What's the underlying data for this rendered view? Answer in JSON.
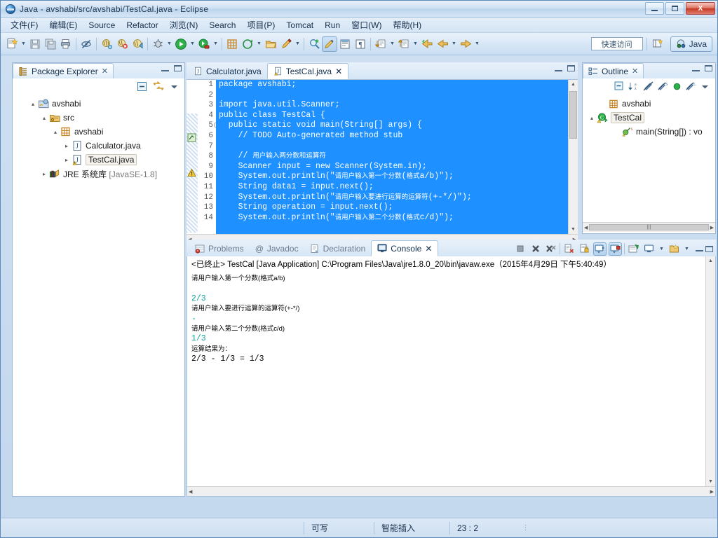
{
  "window": {
    "title": "Java - avshabi/src/avshabi/TestCal.java - Eclipse",
    "minimize_label": "Minimize",
    "maximize_label": "Maximize",
    "close_label": "X"
  },
  "menubar": {
    "items": [
      {
        "label": "文件(F)",
        "mnemonic": "F"
      },
      {
        "label": "编辑(E)",
        "mnemonic": "E"
      },
      {
        "label": "Source",
        "mnemonic": "S"
      },
      {
        "label": "Refactor",
        "mnemonic": "R"
      },
      {
        "label": "浏览(N)",
        "mnemonic": "N"
      },
      {
        "label": "Search",
        "mnemonic": "a"
      },
      {
        "label": "项目(P)",
        "mnemonic": "P"
      },
      {
        "label": "Tomcat",
        "mnemonic": ""
      },
      {
        "label": "Run",
        "mnemonic": "R"
      },
      {
        "label": "窗口(W)",
        "mnemonic": "W"
      },
      {
        "label": "帮助(H)",
        "mnemonic": "H"
      }
    ]
  },
  "toolbar": {
    "quick_access": "快速访问",
    "perspective": "Java",
    "icons": [
      "new-wizard-icon",
      "new-wizard-dropdown-icon",
      "save-icon",
      "save-all-icon",
      "print-icon",
      "toggle-mark-occurrences-icon",
      "open-type-icon",
      "open-type-error-icon",
      "open-task-icon",
      "debug-icon",
      "debug-dropdown-icon",
      "run-icon",
      "run-dropdown-icon",
      "external-tools-icon",
      "external-tools-dropdown-icon",
      "new-java-project-icon",
      "new-package-icon",
      "open-resource-icon",
      "new-class-icon",
      "new-class-dropdown-icon",
      "search-icon",
      "toggle-block-selection-icon",
      "show-whitespace-icon",
      "pilcrow-icon",
      "next-annotation-icon",
      "next-annotation-dropdown-icon",
      "previous-annotation-icon",
      "previous-annotation-dropdown-icon",
      "back-history-icon",
      "back-icon",
      "back-dropdown-icon",
      "forward-icon",
      "forward-dropdown-icon",
      "open-perspective-icon"
    ]
  },
  "package_explorer": {
    "tab_label": "Package Explorer",
    "close_label": "✕",
    "tools": [
      "collapse-all-icon",
      "link-with-editor-icon",
      "view-menu-icon"
    ],
    "tree": [
      {
        "label": "avshabi",
        "indent": 0,
        "arrow": "▴",
        "icon": "java-project-icon",
        "selected": false
      },
      {
        "label": "src",
        "indent": 1,
        "arrow": "▴",
        "icon": "source-folder-icon",
        "selected": false
      },
      {
        "label": "avshabi",
        "indent": 2,
        "arrow": "▴",
        "icon": "package-icon",
        "selected": false
      },
      {
        "label": "Calculator.java",
        "indent": 3,
        "arrow": "▸",
        "icon": "java-file-icon",
        "selected": false
      },
      {
        "label": "TestCal.java",
        "indent": 3,
        "arrow": "▸",
        "icon": "java-file-warning-icon",
        "selected": true
      },
      {
        "label": "JRE 系统库",
        "suffix": "[JavaSE-1.8]",
        "indent": 1,
        "arrow": "▸",
        "icon": "library-icon",
        "selected": false
      }
    ]
  },
  "editor": {
    "tabs": [
      {
        "label": "Calculator.java",
        "active": false,
        "icon": "java-file-icon",
        "closeable": false
      },
      {
        "label": "TestCal.java",
        "active": true,
        "icon": "java-file-warning-icon",
        "closeable": true,
        "close_label": "✕"
      }
    ],
    "first_line": 1,
    "lines": [
      {
        "n": 1,
        "folding": false,
        "text": "package avshabi;"
      },
      {
        "n": 2,
        "folding": false,
        "text": ""
      },
      {
        "n": 3,
        "folding": false,
        "text": "import java.util.Scanner;"
      },
      {
        "n": 4,
        "folding": false,
        "text": "public class TestCal {"
      },
      {
        "n": 5,
        "folding": true,
        "text": "  public static void main(String[] args) {"
      },
      {
        "n": 6,
        "folding": false,
        "text": "    // TODO Auto-generated method stub"
      },
      {
        "n": 7,
        "folding": false,
        "text": ""
      },
      {
        "n": 8,
        "folding": false,
        "text": "    // 用户输入两分数和运算符"
      },
      {
        "n": 9,
        "folding": false,
        "text": "    Scanner input = new Scanner(System.in);"
      },
      {
        "n": 10,
        "folding": false,
        "text": "    System.out.println(\"请用户输入第一个分数(格式a/b)\");"
      },
      {
        "n": 11,
        "folding": false,
        "text": "    String data1 = input.next();"
      },
      {
        "n": 12,
        "folding": false,
        "text": "    System.out.println(\"请用户输入要进行运算的运算符(+-*/)\");"
      },
      {
        "n": 13,
        "folding": false,
        "text": "    String operation = input.next();"
      },
      {
        "n": 14,
        "folding": false,
        "text": "    System.out.println(\"请用户输入第二个分数(格式c/d)\");"
      }
    ]
  },
  "outline": {
    "tab_label": "Outline",
    "close_label": "✕",
    "tools": [
      "collapse-all-icon",
      "sort-icon",
      "hide-fields-icon",
      "hide-static-icon",
      "hide-nonpublic-icon",
      "hide-local-icon",
      "view-menu-icon"
    ],
    "tree": [
      {
        "label": "avshabi",
        "indent": 1,
        "arrow": "",
        "icon": "package-declaration-icon",
        "selected": false
      },
      {
        "label": "TestCal",
        "indent": 1,
        "arrow": "▴",
        "icon": "class-warning-icon",
        "selected": true
      },
      {
        "label": "main(String[]) : vo",
        "indent": 2,
        "arrow": "",
        "icon": "static-method-icon",
        "selected": false
      }
    ]
  },
  "console": {
    "tabs": [
      {
        "label": "Problems",
        "active": false,
        "icon": "problems-icon"
      },
      {
        "label": "Javadoc",
        "active": false,
        "icon": "javadoc-icon"
      },
      {
        "label": "Declaration",
        "active": false,
        "icon": "declaration-icon"
      },
      {
        "label": "Console",
        "active": true,
        "icon": "console-icon",
        "close_label": "✕"
      }
    ],
    "tools": [
      "terminate-icon",
      "remove-launch-icon",
      "remove-all-launches-icon",
      "clear-console-icon",
      "scroll-lock-icon",
      "pin-console-icon",
      "display-selected-console-icon",
      "open-console-icon",
      "open-console-dropdown-icon",
      "new-console-view-icon",
      "new-console-dropdown-icon",
      "minimize-icon",
      "maximize-icon"
    ],
    "header": "<已终止> TestCal [Java Application] C:\\Program Files\\Java\\jre1.8.0_20\\bin\\javaw.exe（2015年4月29日 下午5:40:49）",
    "output": [
      {
        "text": "请用户输入第一个分数(格式a/b)",
        "style": "zh"
      },
      {
        "text": "",
        "style": "zh"
      },
      {
        "text": "2/3",
        "style": "inp"
      },
      {
        "text": "请用户输入要进行运算的运算符(+-*/)",
        "style": "zh"
      },
      {
        "text": "-",
        "style": "inp"
      },
      {
        "text": "请用户输入第二个分数(格式c/d)",
        "style": "zh"
      },
      {
        "text": "1/3",
        "style": "inp"
      },
      {
        "text": "运算结果为：",
        "style": "zh"
      },
      {
        "text": "2/3 -  1/3 = 1/3",
        "style": "mono"
      }
    ]
  },
  "statusbar": {
    "writable": "可写",
    "insert_mode": "智能插入",
    "position": "23 : 2"
  },
  "colors": {
    "selection_blue": "#1e90ff",
    "console_input_teal": "#11a39a",
    "accent": "#2a6fb0"
  }
}
